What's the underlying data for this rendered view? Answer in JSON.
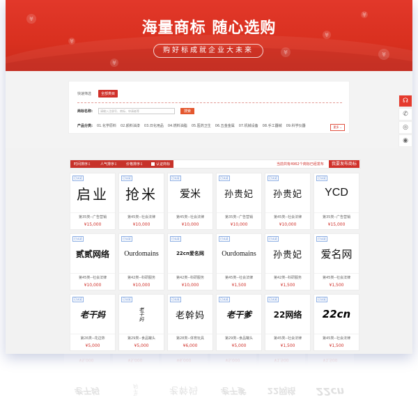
{
  "banner": {
    "title": "海量商标  随心选购",
    "subtitle": "购好标成就企业大未来"
  },
  "filter": {
    "quick_label": "快速筛选",
    "quick_tag": "全部类目",
    "name_label": "商标名称:",
    "search_placeholder": "请输入注册号、商标、申请者等",
    "search_button": "搜索",
    "category_label": "产品分类:",
    "categories": [
      "01.化学原料",
      "02.颜料油漆",
      "03.日化用品",
      "04.燃料油脂",
      "05.医药卫生",
      "06.五金金属",
      "07.机械设备",
      "08.手工器械",
      "09.科学仪器"
    ],
    "more_button": "更多"
  },
  "side_toolbar": {
    "icons": [
      "headset-icon",
      "phone-icon",
      "wechat-icon",
      "chat-icon"
    ]
  },
  "toolbar": {
    "sort_time": "时间排序",
    "sort_popularity": "人气排序",
    "sort_price": "价格排序",
    "verified_label": "认证商标",
    "total_text": "当前共有4962个商标已经发布",
    "publish_button": "我要发布商标"
  },
  "accent_color": "#d0302a",
  "cards": [
    {
      "badge": "已认证",
      "mark": "启业",
      "cls": "第35类--广告营销",
      "price": "¥15,000",
      "style": "hei"
    },
    {
      "badge": "已认证",
      "mark": "抢米",
      "cls": "第45类--社会法律",
      "price": "¥10,000",
      "style": "hei"
    },
    {
      "badge": "已认证",
      "mark": "爱米",
      "cls": "第45类--社会法律",
      "price": "¥10,000",
      "style": "round"
    },
    {
      "badge": "已认证",
      "mark": "孙贵妃",
      "cls": "第35类--广告营销",
      "price": "¥10,000",
      "style": "song"
    },
    {
      "badge": "已认证",
      "mark": "孙贵妃",
      "cls": "第45类--社会法律",
      "price": "¥10,000",
      "style": "song"
    },
    {
      "badge": "已认证",
      "mark": "YCD",
      "cls": "第35类--广告营销",
      "price": "¥15,000",
      "style": "latin"
    },
    {
      "badge": "已认证",
      "mark": "贰贰网络",
      "cls": "第45类--社会法律",
      "price": "¥10,000",
      "style": "bold"
    },
    {
      "badge": "已认证",
      "mark": "Ourdomains",
      "cls": "第42类--科研服务",
      "price": "¥10,000",
      "style": "serif"
    },
    {
      "badge": "已认证",
      "mark": "22cn爱名网",
      "cls": "第42类--科研服务",
      "price": "¥10,000",
      "style": "logo"
    },
    {
      "badge": "已认证",
      "mark": "Ourdomains",
      "cls": "第45类--社会法律",
      "price": "¥1,500",
      "style": "serif"
    },
    {
      "badge": "已认证",
      "mark": "孙贵妃",
      "cls": "第42类--科研服务",
      "price": "¥1,500",
      "style": "song"
    },
    {
      "badge": "已认证",
      "mark": "爱名网",
      "cls": "第45类--社会法律",
      "price": "¥1,500",
      "style": "round"
    },
    {
      "badge": "已认证",
      "mark": "老干妈",
      "cls": "第26类--花边饰",
      "price": "¥5,000",
      "style": "brush"
    },
    {
      "badge": "已认证",
      "mark": "老干妈",
      "cls": "第29类--食品罐头",
      "price": "¥5,000",
      "style": "brush-small"
    },
    {
      "badge": "已认证",
      "mark": "老幹妈",
      "cls": "第28类--体育玩具",
      "price": "¥6,000",
      "style": "song"
    },
    {
      "badge": "已认证",
      "mark": "老干爹",
      "cls": "第29类--食品罐头",
      "price": "¥5,000",
      "style": "brush"
    },
    {
      "badge": "已认证",
      "mark": "22网络",
      "cls": "第45类--社会法律",
      "price": "¥1,500",
      "style": "bold"
    },
    {
      "badge": "已认证",
      "mark": "22cn",
      "cls": "第45类--社会法律",
      "price": "¥1,500",
      "style": "logo-big"
    }
  ]
}
